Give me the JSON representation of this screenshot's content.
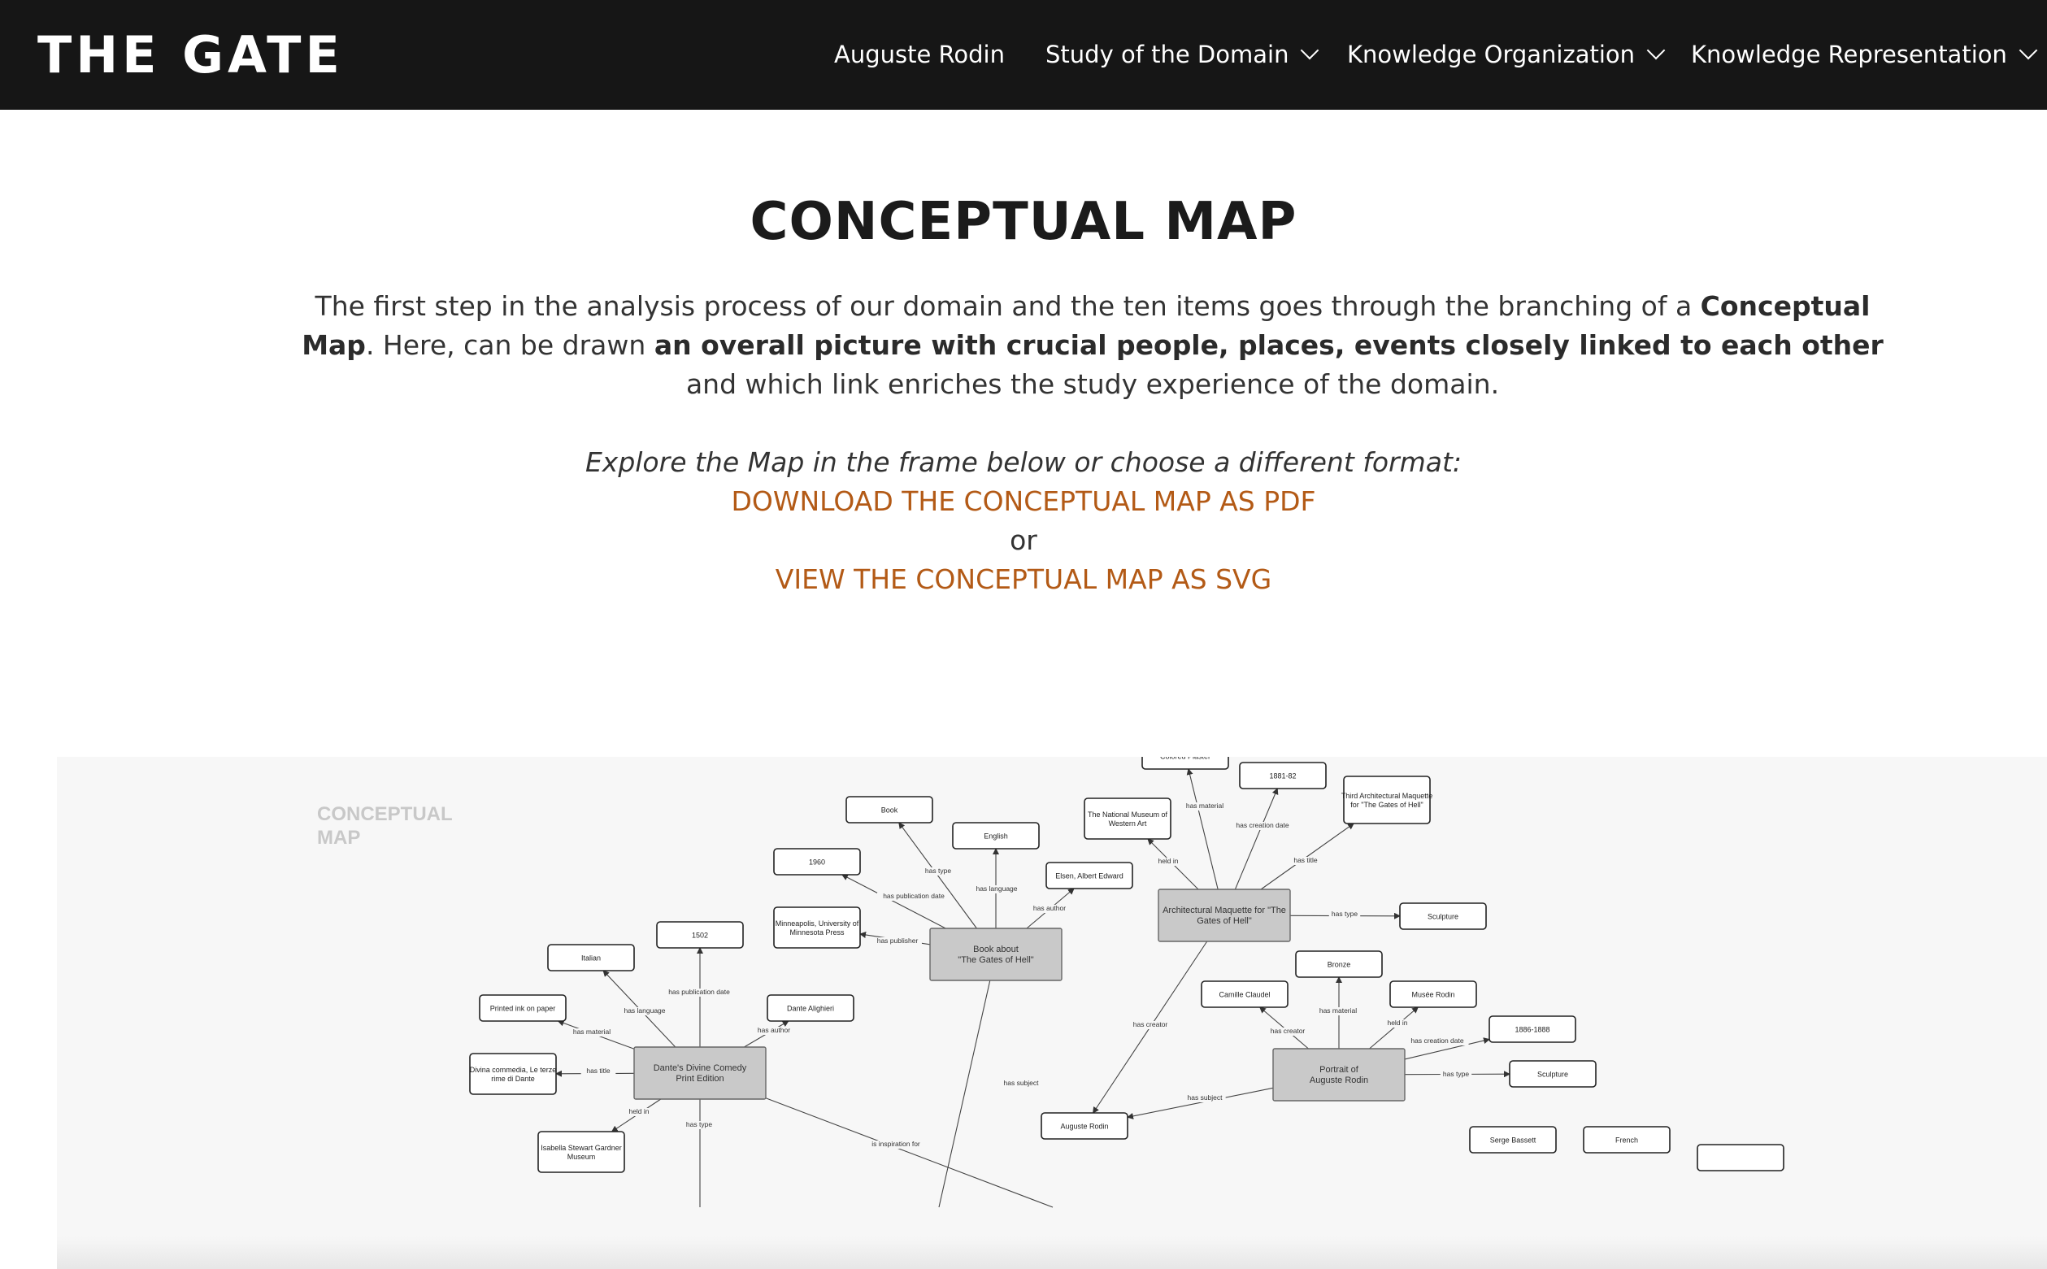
{
  "brand": "THE GATE",
  "nav": {
    "items": [
      {
        "label": "Auguste Rodin"
      },
      {
        "label": "Study of the Domain"
      },
      {
        "label": "Knowledge Organization"
      },
      {
        "label": "Knowledge Representation"
      }
    ]
  },
  "page": {
    "title": "CONCEPTUAL MAP",
    "intro_1": "The first step in the analysis process of our domain and the ten items goes through the branching of a ",
    "intro_bold_1": "Conceptual Map",
    "intro_2": ". Here, can be drawn ",
    "intro_bold_2": "an overall picture with crucial people, places, events closely linked to each other",
    "intro_3": " and which link enriches the study experience of the domain.",
    "explore": "Explore the Map in the frame below or choose a different format:",
    "download_link": "DOWNLOAD THE CONCEPTUAL MAP AS PDF",
    "or": "or",
    "svg_link": "VIEW THE CONCEPTUAL MAP AS SVG"
  },
  "frame": {
    "label": "CONCEPTUAL MAP"
  },
  "map": {
    "nodes": [
      {
        "id": "colored_plaster",
        "text": [
          "Colored Plaster"
        ]
      },
      {
        "id": "date_1881",
        "text": [
          "1881-82"
        ]
      },
      {
        "id": "third_maquette",
        "text": [
          "Third Architectural Maquette",
          "for \"The Gates of Hell\""
        ]
      },
      {
        "id": "book",
        "text": [
          "Book"
        ]
      },
      {
        "id": "english",
        "text": [
          "English"
        ]
      },
      {
        "id": "nmwa",
        "text": [
          "The National Museum of",
          "Western Art"
        ]
      },
      {
        "id": "y1960",
        "text": [
          "1960"
        ]
      },
      {
        "id": "elsen",
        "text": [
          "Elsen, Albert Edward"
        ]
      },
      {
        "id": "minneapolis",
        "text": [
          "Minneapolis, University of",
          "Minnesota Press"
        ]
      },
      {
        "id": "sculpture1",
        "text": [
          "Sculpture"
        ]
      },
      {
        "id": "y1502",
        "text": [
          "1502"
        ]
      },
      {
        "id": "italian",
        "text": [
          "Italian"
        ]
      },
      {
        "id": "bronze",
        "text": [
          "Bronze"
        ]
      },
      {
        "id": "camille",
        "text": [
          "Camille Claudel"
        ]
      },
      {
        "id": "musee",
        "text": [
          "Musée Rodin"
        ]
      },
      {
        "id": "printed",
        "text": [
          "Printed ink on paper"
        ]
      },
      {
        "id": "dante_a",
        "text": [
          "Dante Alighieri"
        ]
      },
      {
        "id": "y1886",
        "text": [
          "1886-1888"
        ]
      },
      {
        "id": "divina",
        "text": [
          "Divina commedia, Le terze",
          "rime di Dante"
        ]
      },
      {
        "id": "sculpture2",
        "text": [
          "Sculpture"
        ]
      },
      {
        "id": "auguste",
        "text": [
          "Auguste Rodin"
        ]
      },
      {
        "id": "isabella",
        "text": [
          "Isabella Stewart Gardner",
          "Museum"
        ]
      },
      {
        "id": "serge",
        "text": [
          "Serge Bassett"
        ]
      },
      {
        "id": "french",
        "text": [
          "French"
        ]
      }
    ],
    "hubs": [
      {
        "id": "arch_maquette",
        "text": [
          "Architectural Maquette for \"The",
          "Gates of Hell\""
        ]
      },
      {
        "id": "book_about",
        "text": [
          "Book about",
          "\"The Gates of Hell\""
        ]
      },
      {
        "id": "dantes",
        "text": [
          "Dante's Divine Comedy",
          "Print Edition"
        ]
      },
      {
        "id": "portrait",
        "text": [
          "Portrait of",
          "Auguste Rodin"
        ]
      }
    ],
    "edges": [
      {
        "label": "has material"
      },
      {
        "label": "has creation date"
      },
      {
        "label": "has title"
      },
      {
        "label": "held in"
      },
      {
        "label": "has type"
      },
      {
        "label": "has type"
      },
      {
        "label": "has language"
      },
      {
        "label": "has publication date"
      },
      {
        "label": "has author"
      },
      {
        "label": "has publisher"
      },
      {
        "label": "has subject"
      },
      {
        "label": "has publication date"
      },
      {
        "label": "has language"
      },
      {
        "label": "has author"
      },
      {
        "label": "has material"
      },
      {
        "label": "has title"
      },
      {
        "label": "held in"
      },
      {
        "label": "has type"
      },
      {
        "label": "is inspiration for"
      },
      {
        "label": "has creator"
      },
      {
        "label": "has material"
      },
      {
        "label": "has creator"
      },
      {
        "label": "held in"
      },
      {
        "label": "has creation date"
      },
      {
        "label": "has type"
      },
      {
        "label": "has subject"
      }
    ]
  }
}
